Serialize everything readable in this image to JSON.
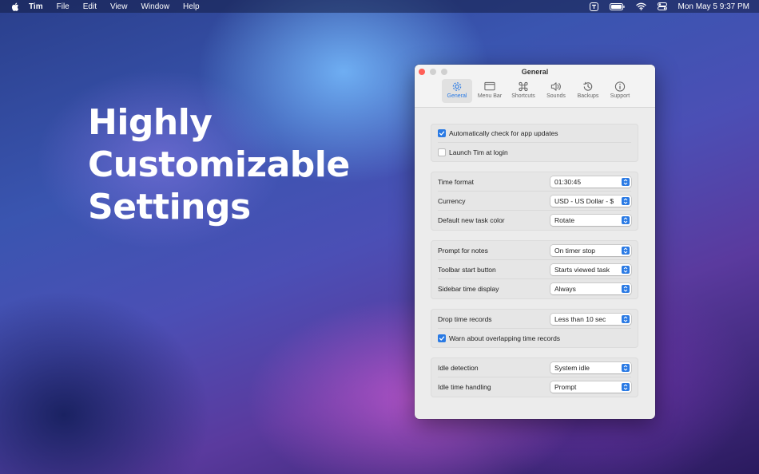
{
  "menubar": {
    "app_name": "Tim",
    "items": [
      "File",
      "Edit",
      "View",
      "Window",
      "Help"
    ],
    "clock": "Mon May 5  9:37 PM",
    "tray_icons": [
      "tim-icon",
      "battery-icon",
      "wifi-icon",
      "control-center-icon"
    ]
  },
  "hero": {
    "line1": "Highly",
    "line2": "Customizable",
    "line3": "Settings"
  },
  "window": {
    "title": "General",
    "tabs": [
      {
        "label": "General",
        "icon": "gear-icon",
        "active": true
      },
      {
        "label": "Menu Bar",
        "icon": "menubar-icon",
        "active": false
      },
      {
        "label": "Shortcuts",
        "icon": "command-icon",
        "active": false
      },
      {
        "label": "Sounds",
        "icon": "speaker-icon",
        "active": false
      },
      {
        "label": "Backups",
        "icon": "history-icon",
        "active": false
      },
      {
        "label": "Support",
        "icon": "info-icon",
        "active": false
      }
    ],
    "updates": {
      "auto_check": {
        "label": "Automatically check for app updates",
        "checked": true
      },
      "launch_login": {
        "label": "Launch Tim at login",
        "checked": false
      }
    },
    "format": {
      "time_format": {
        "label": "Time format",
        "value": "01:30:45"
      },
      "currency": {
        "label": "Currency",
        "value": "USD - US Dollar - $"
      },
      "task_color": {
        "label": "Default new task color",
        "value": "Rotate"
      }
    },
    "behavior": {
      "prompt_notes": {
        "label": "Prompt for notes",
        "value": "On timer stop"
      },
      "toolbar_start": {
        "label": "Toolbar start button",
        "value": "Starts viewed task"
      },
      "sidebar_time": {
        "label": "Sidebar time display",
        "value": "Always"
      }
    },
    "records": {
      "drop_records": {
        "label": "Drop time records",
        "value": "Less than 10 sec"
      },
      "warn_overlap": {
        "label": "Warn about overlapping time records",
        "checked": true
      }
    },
    "idle": {
      "detection": {
        "label": "Idle detection",
        "value": "System idle"
      },
      "handling": {
        "label": "Idle time handling",
        "value": "Prompt"
      }
    }
  },
  "colors": {
    "accent": "#2a7ae4",
    "close_button": "#ff5f57"
  }
}
